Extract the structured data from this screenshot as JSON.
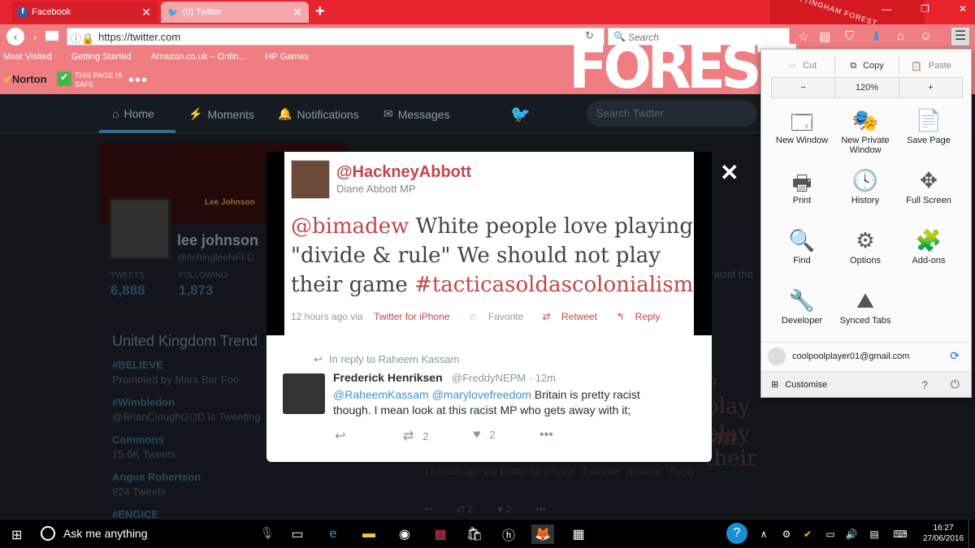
{
  "browser": {
    "tabs": [
      {
        "label": "Facebook"
      },
      {
        "label": "(0) Twitter"
      }
    ],
    "url": "https://twitter.com",
    "search_placeholder": "Search",
    "bookmarks": [
      "Most Visited",
      "Getting Started",
      "Amazon.co.uk – Onlin...",
      "HP Games"
    ],
    "norton": {
      "label": "Norton",
      "status_line1": "THIS PAGE IS",
      "status_line2": "SAFE"
    },
    "overlay_brand": "FOREST"
  },
  "twitter_bg": {
    "nav": {
      "home": "Home",
      "moments": "Moments",
      "notifications": "Notifications",
      "messages": "Messages",
      "search_placeholder": "Search Twitter"
    },
    "profile": {
      "name": "lee johnson",
      "handle": "@fishingleeNFFC",
      "banner_text": "Lee Johnson",
      "tweets_label": "TWEETS",
      "tweets": "6,888",
      "following_label": "FOLLOWING",
      "following": "1,873"
    },
    "trends": {
      "title": "United Kingdom Trend",
      "items": [
        {
          "name": "#BELIEVE",
          "sub": "Promoted by Mars Bar Foo"
        },
        {
          "name": "#Wimbledon",
          "sub": "@BrianCloughGOD is Tweeting"
        },
        {
          "name": "Commons",
          "sub": "15.6K Tweets"
        },
        {
          "name": "Angus Robertson",
          "sub": "924 Tweets"
        },
        {
          "name": "#ENGICE",
          "sub": ""
        }
      ]
    },
    "bg_tweet_fragments": [
      "e play",
      "t play their",
      "sm",
      "racist tho"
    ],
    "bg_meta": "12 hours ago via Twitter for iPhone",
    "bg_fav": "Favorite",
    "bg_rt": "Retweet",
    "bg_reply": "Reply",
    "bg_counts": [
      "2",
      "2"
    ]
  },
  "media_tweet": {
    "handle": "@HackneyAbbott",
    "name": "Diane Abbott MP",
    "mention": "@bimadew",
    "text": " White people love playing \"divide & rule\" We should not play their game ",
    "hashtag": "#tacticasoldascolonialism",
    "time": "12 hours ago via ",
    "client": "Twitter for iPhone",
    "favorite": "Favorite",
    "retweet": "Retweet",
    "reply": "Reply"
  },
  "reply_tweet": {
    "in_reply_to": "In reply to Raheem Kassam",
    "name": "Frederick Henriksen",
    "handle": "@FreddyNEPM",
    "time": "· 12m",
    "mention1": "@RaheemKassam",
    "mention2": "@marylovefreedom",
    "text": " Britain is pretty racist though. I mean look at this racist MP who gets away with it;",
    "retweets": "2",
    "likes": "2"
  },
  "ff_menu": {
    "cut": "Cut",
    "copy": "Copy",
    "paste": "Paste",
    "zoom_minus": "−",
    "zoom": "120%",
    "zoom_plus": "+",
    "items": [
      {
        "label": "New Window"
      },
      {
        "label": "New Private Window"
      },
      {
        "label": "Save Page"
      },
      {
        "label": "Print"
      },
      {
        "label": "History"
      },
      {
        "label": "Full Screen"
      },
      {
        "label": "Find"
      },
      {
        "label": "Options"
      },
      {
        "label": "Add-ons"
      },
      {
        "label": "Developer"
      },
      {
        "label": "Synced Tabs"
      }
    ],
    "account": "coolpoolplayer01@gmail.com",
    "customise": "Customise"
  },
  "taskbar": {
    "cortana": "Ask me anything",
    "time": "16:27",
    "date": "27/06/2016"
  },
  "colors": {
    "firefox_red": "#e8232d",
    "twitter_link": "#3b94d9",
    "abbott_red": "#c3464b"
  }
}
